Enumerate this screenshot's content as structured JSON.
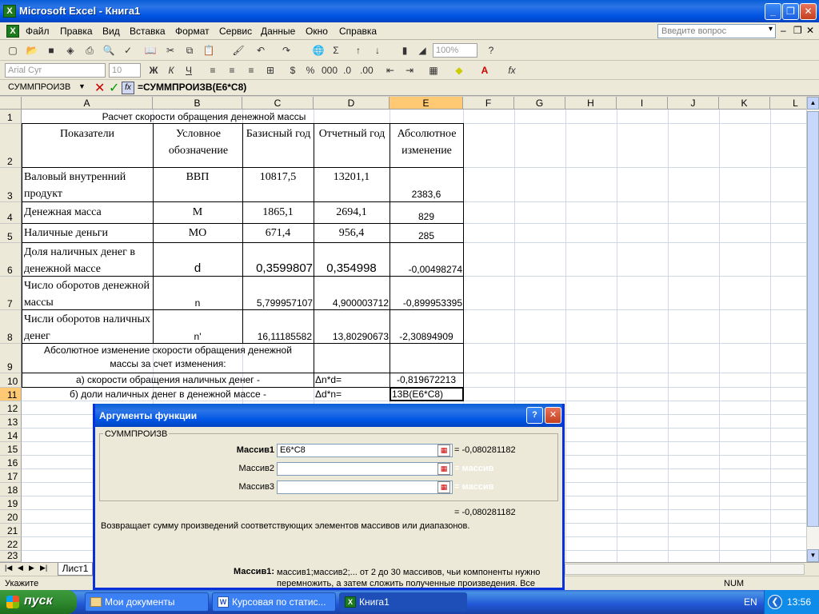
{
  "window": {
    "title": "Microsoft Excel - Книга1"
  },
  "menu": {
    "items": [
      "Файл",
      "Правка",
      "Вид",
      "Вставка",
      "Формат",
      "Сервис",
      "Данные",
      "Окно",
      "Справка"
    ],
    "question_placeholder": "Введите вопрос"
  },
  "toolbar": {
    "zoom": "100%",
    "font_name": "Arial Cyr",
    "font_size": "10"
  },
  "formula_bar": {
    "name_box": "СУММПРОИЗВ",
    "formula": "=СУММПРОИЗВ(E6*C8)"
  },
  "columns": [
    "A",
    "B",
    "C",
    "D",
    "E",
    "F",
    "G",
    "H",
    "I",
    "J",
    "K",
    "L"
  ],
  "rows": [
    "1",
    "2",
    "3",
    "4",
    "5",
    "6",
    "7",
    "8",
    "9",
    "10",
    "11",
    "12",
    "13",
    "14",
    "15",
    "16",
    "17",
    "18",
    "19",
    "20",
    "21",
    "22",
    "23"
  ],
  "sheet": {
    "title": "Расчет скорости обращения денежной массы",
    "headers": [
      "Показатели",
      "Условное обозначение",
      "Базисный год",
      "Отчетный год",
      "Абсолютное изменение"
    ],
    "r3": [
      "Валовый внутренний продукт",
      "ВВП",
      "10817,5",
      "13201,1",
      "2383,6"
    ],
    "r4": [
      "Денежная масса",
      "М",
      "1865,1",
      "2694,1",
      "829"
    ],
    "r5": [
      "Наличные деньги",
      "МО",
      "671,4",
      "956,4",
      "285"
    ],
    "r6": [
      "Доля наличных денег в денежной массе",
      "d",
      "0,3599807",
      "0,354998",
      "-0,00498274"
    ],
    "r7": [
      "Число оборотов денежной массы",
      "n",
      "5,799957107",
      "4,900003712",
      "-0,899953395"
    ],
    "r8": [
      "Числи оборотов наличных денег",
      "n'",
      "16,11185582",
      "13,80290673",
      "-2,30894909"
    ],
    "r9": "Абсолютное изменение скорости обращения денежной массы за счет изменения:",
    "r10": [
      "а) скорости обращения наличных денег -",
      "Δn*d=",
      "-0,819672213"
    ],
    "r11": [
      "б) доли наличных денег в денежной массе -",
      "Δd*n=",
      "13В(E6*C8)"
    ]
  },
  "sheet_tab": "Лист1",
  "status": {
    "left": "Укажите",
    "num": "NUM"
  },
  "dialog": {
    "title": "Аргументы функции",
    "group": "СУММПРОИЗВ",
    "labels": [
      "Массив1",
      "Массив2",
      "Массив3"
    ],
    "values": [
      "E6*C8",
      "",
      ""
    ],
    "results": [
      "= -0,080281182",
      "= массив",
      "= массив"
    ],
    "total": "= -0,080281182",
    "description": "Возвращает сумму произведений соответствующих элементов массивов или диапазонов.",
    "help_label": "Массив1:",
    "help_text": "массив1;массив2;... от 2 до 30 массивов, чьи компоненты нужно перемножить, а затем сложить полученные произведения. Все"
  },
  "taskbar": {
    "start": "пуск",
    "items": [
      "Мои документы",
      "Курсовая по статис...",
      "Книга1"
    ],
    "lang": "EN",
    "time": "13:56"
  }
}
